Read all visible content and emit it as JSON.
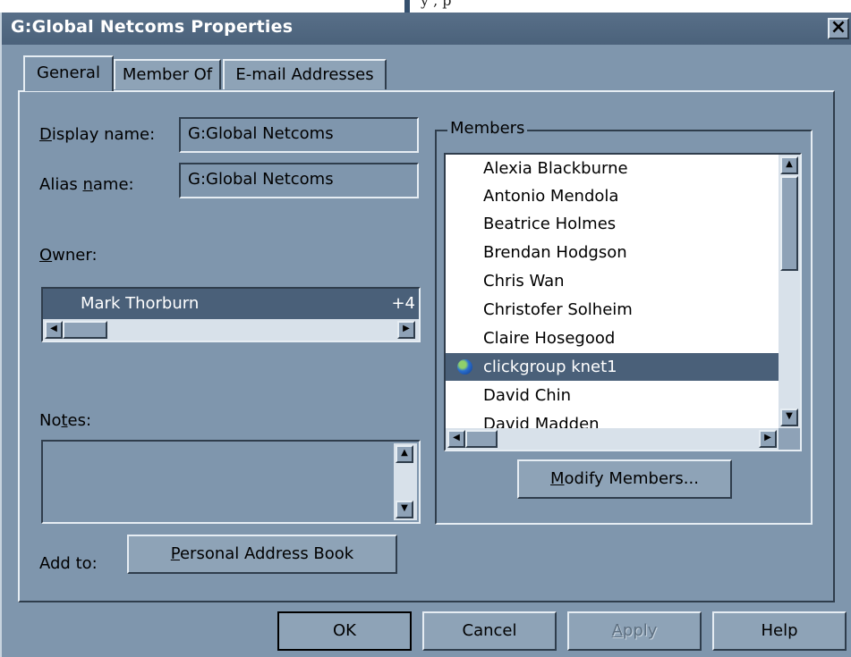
{
  "top_fragment": "y                                                                        ,    p",
  "window": {
    "title": "G:Global Netcoms Properties",
    "close_glyph": "×"
  },
  "tabs": [
    {
      "label": "General",
      "active": true
    },
    {
      "label": "Member Of",
      "active": false
    },
    {
      "label": "E-mail Addresses",
      "active": false
    }
  ],
  "general": {
    "display_name_label_ul": "D",
    "display_name_label_rest": "isplay name:",
    "display_name_value": "G:Global Netcoms",
    "alias_label_pre": "Alias ",
    "alias_label_ul": "n",
    "alias_label_post": "ame:",
    "alias_value": "G:Global Netcoms",
    "owner_label_ul": "O",
    "owner_label_rest": "wner:",
    "owner_name": "Mark Thorburn",
    "owner_extra": "+4",
    "notes_label_pre": "No",
    "notes_label_ul": "t",
    "notes_label_post": "es:",
    "add_to_label": "Add to:",
    "pab_button_ul": "P",
    "pab_button_rest": "ersonal Address Book"
  },
  "members": {
    "legend": "Members",
    "items": [
      {
        "name": "Alexia Blackburne"
      },
      {
        "name": "Antonio Mendola"
      },
      {
        "name": "Beatrice Holmes"
      },
      {
        "name": "Brendan Hodgson"
      },
      {
        "name": "Chris Wan"
      },
      {
        "name": "Christofer Solheim"
      },
      {
        "name": "Claire Hosegood"
      },
      {
        "name": "clickgroup knet1"
      },
      {
        "name": "David Chin"
      },
      {
        "name": "David Madden"
      }
    ],
    "modify_button_ul": "M",
    "modify_button_rest": "odify Members..."
  },
  "buttons": {
    "ok": "OK",
    "cancel": "Cancel",
    "apply_ul": "A",
    "apply_rest": "pply",
    "help": "Help"
  },
  "colors": {
    "window_bg": "#7f96ad",
    "titlebar": "#4b627b",
    "selection": "#4a6079"
  }
}
